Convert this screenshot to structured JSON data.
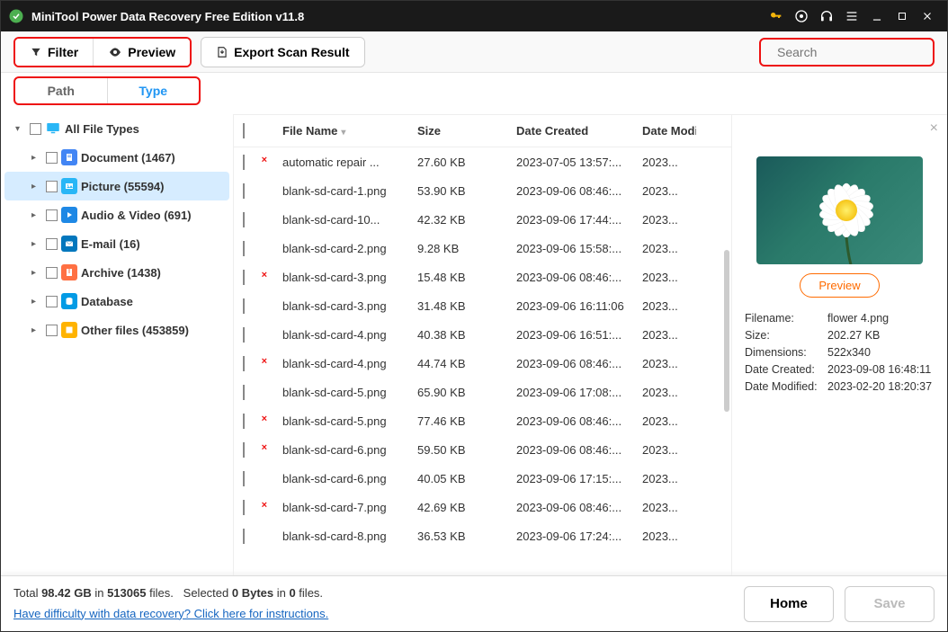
{
  "app_title": "MiniTool Power Data Recovery Free Edition v11.8",
  "toolbar": {
    "filter": "Filter",
    "preview": "Preview",
    "export": "Export Scan Result",
    "search_placeholder": "Search"
  },
  "tabs": {
    "path": "Path",
    "type": "Type"
  },
  "sidebar": {
    "root": "All File Types",
    "items": [
      {
        "label": "Document (1467)",
        "color": "#4285f4",
        "icon": "doc"
      },
      {
        "label": "Picture (55594)",
        "color": "#29b6f6",
        "icon": "pic",
        "selected": true
      },
      {
        "label": "Audio & Video (691)",
        "color": "#1e88e5",
        "icon": "av"
      },
      {
        "label": "E-mail (16)",
        "color": "#0277bd",
        "icon": "mail",
        "outlook": true
      },
      {
        "label": "Archive (1438)",
        "color": "#ff7043",
        "icon": "arc"
      },
      {
        "label": "Database",
        "color": "#039be5",
        "icon": "db"
      },
      {
        "label": "Other files (453859)",
        "color": "#ffb300",
        "icon": "other"
      }
    ]
  },
  "columns": {
    "name": "File Name",
    "size": "Size",
    "created": "Date Created",
    "modified": "Date Modif"
  },
  "files": [
    {
      "name": "automatic repair ...",
      "size": "27.60 KB",
      "created": "2023-07-05 13:57:...",
      "modified": "2023...",
      "deleted": true
    },
    {
      "name": "blank-sd-card-1.png",
      "size": "53.90 KB",
      "created": "2023-09-06 08:46:...",
      "modified": "2023..."
    },
    {
      "name": "blank-sd-card-10...",
      "size": "42.32 KB",
      "created": "2023-09-06 17:44:...",
      "modified": "2023..."
    },
    {
      "name": "blank-sd-card-2.png",
      "size": "9.28 KB",
      "created": "2023-09-06 15:58:...",
      "modified": "2023..."
    },
    {
      "name": "blank-sd-card-3.png",
      "size": "15.48 KB",
      "created": "2023-09-06 08:46:...",
      "modified": "2023...",
      "deleted": true
    },
    {
      "name": "blank-sd-card-3.png",
      "size": "31.48 KB",
      "created": "2023-09-06 16:11:06",
      "modified": "2023..."
    },
    {
      "name": "blank-sd-card-4.png",
      "size": "40.38 KB",
      "created": "2023-09-06 16:51:...",
      "modified": "2023..."
    },
    {
      "name": "blank-sd-card-4.png",
      "size": "44.74 KB",
      "created": "2023-09-06 08:46:...",
      "modified": "2023...",
      "deleted": true
    },
    {
      "name": "blank-sd-card-5.png",
      "size": "65.90 KB",
      "created": "2023-09-06 17:08:...",
      "modified": "2023..."
    },
    {
      "name": "blank-sd-card-5.png",
      "size": "77.46 KB",
      "created": "2023-09-06 08:46:...",
      "modified": "2023...",
      "deleted": true
    },
    {
      "name": "blank-sd-card-6.png",
      "size": "59.50 KB",
      "created": "2023-09-06 08:46:...",
      "modified": "2023...",
      "deleted": true
    },
    {
      "name": "blank-sd-card-6.png",
      "size": "40.05 KB",
      "created": "2023-09-06 17:15:...",
      "modified": "2023..."
    },
    {
      "name": "blank-sd-card-7.png",
      "size": "42.69 KB",
      "created": "2023-09-06 08:46:...",
      "modified": "2023...",
      "deleted": true
    },
    {
      "name": "blank-sd-card-8.png",
      "size": "36.53 KB",
      "created": "2023-09-06 17:24:...",
      "modified": "2023..."
    }
  ],
  "preview": {
    "button": "Preview",
    "filename_label": "Filename:",
    "filename": "flower 4.png",
    "size_label": "Size:",
    "size": "202.27 KB",
    "dimensions_label": "Dimensions:",
    "dimensions": "522x340",
    "created_label": "Date Created:",
    "created": "2023-09-08 16:48:11",
    "modified_label": "Date Modified:",
    "modified": "2023-02-20 18:20:37"
  },
  "status": {
    "total_prefix": "Total ",
    "total_size": "98.42 GB",
    "total_mid": " in ",
    "total_files": "513065",
    "total_suffix": " files.",
    "sel_prefix": "Selected ",
    "sel_size": "0 Bytes",
    "sel_mid": " in ",
    "sel_count": "0",
    "sel_suffix": " files.",
    "help_link": "Have difficulty with data recovery? Click here for instructions.",
    "home": "Home",
    "save": "Save"
  }
}
